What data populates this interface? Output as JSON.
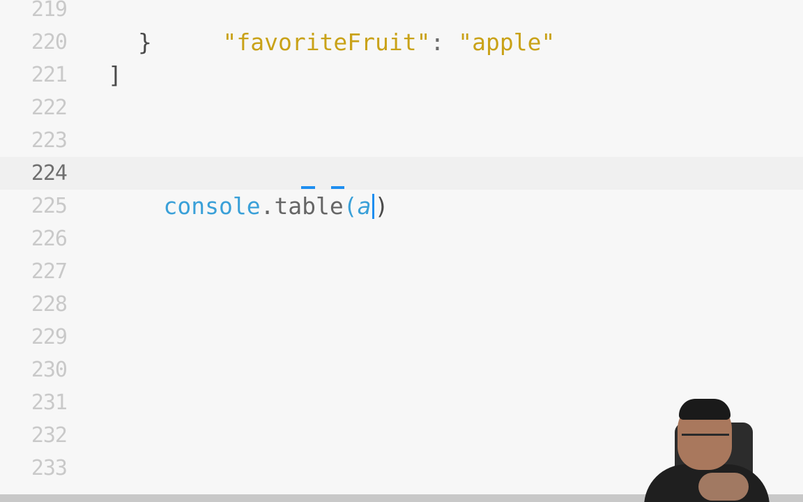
{
  "editor": {
    "line_numbers": [
      "219",
      "220",
      "221",
      "222",
      "223",
      "224",
      "225",
      "226",
      "227",
      "228",
      "229",
      "230",
      "231",
      "232",
      "233"
    ],
    "current_line": "224",
    "lines": {
      "l219": {
        "open_quote_key": "\"favoriteFruit\"",
        "colon": ": ",
        "value": "\"apple\""
      },
      "l220": {
        "text": "}"
      },
      "l221": {
        "text": "]"
      },
      "l224": {
        "object": "console",
        "dot": ".",
        "method": "table",
        "open_paren": "(",
        "arg": "a",
        "close_paren": ")"
      }
    }
  }
}
